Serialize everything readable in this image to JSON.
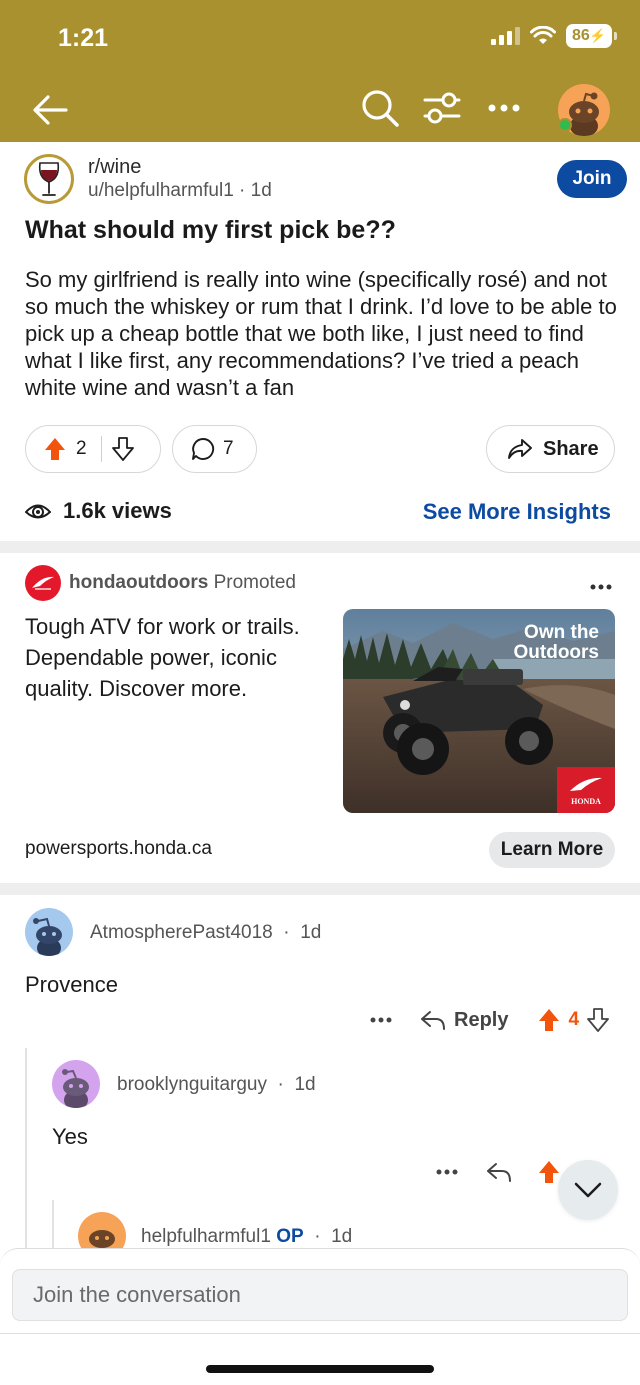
{
  "status_bar": {
    "time": "1:21",
    "battery": "86"
  },
  "nav": {
    "icons": [
      "back-arrow-icon",
      "search-icon",
      "filter-icon",
      "more-icon",
      "user-avatar"
    ],
    "online_color": "#2fbb4f"
  },
  "colors": {
    "header": "#a8912e",
    "accent": "#0d4aa1",
    "upvote": "#f2540c",
    "honda_red": "#e4182b"
  },
  "post": {
    "subreddit": "r/wine",
    "author": "u/helpfulharmful1",
    "separator": "·",
    "age": "1d",
    "join_label": "Join",
    "title": "What should my first pick be??",
    "body": "So my girlfriend is really into wine (specifically rosé) and not so much the whiskey or rum that I drink. I’d love to be able to pick up a cheap bottle that we both like, I just need to find what I like first, any recommendations? I’ve tried a peach white wine and wasn’t a fan",
    "votes": "2",
    "comments": "7",
    "share_label": "Share",
    "views": "1.6k views",
    "insights_label": "See More Insights"
  },
  "ad": {
    "advertiser": "hondaoutdoors",
    "promoted": "Promoted",
    "text": "Tough ATV for work or trails. Dependable power, iconic quality. Discover more.",
    "image_headline_1": "Own the",
    "image_headline_2": "Outdoors",
    "badge_text": "HONDA",
    "domain": "powersports.honda.ca",
    "cta": "Learn More"
  },
  "comments": [
    {
      "author": "AtmospherePast4018",
      "age": "1d",
      "text": "Provence",
      "reply_label": "Reply",
      "votes": "4"
    },
    {
      "author": "brooklynguitarguy",
      "age": "1d",
      "text": "Yes"
    },
    {
      "author": "helpfulharmful1",
      "op_label": "OP",
      "age": "1d"
    }
  ],
  "composer": {
    "placeholder": "Join the conversation"
  }
}
